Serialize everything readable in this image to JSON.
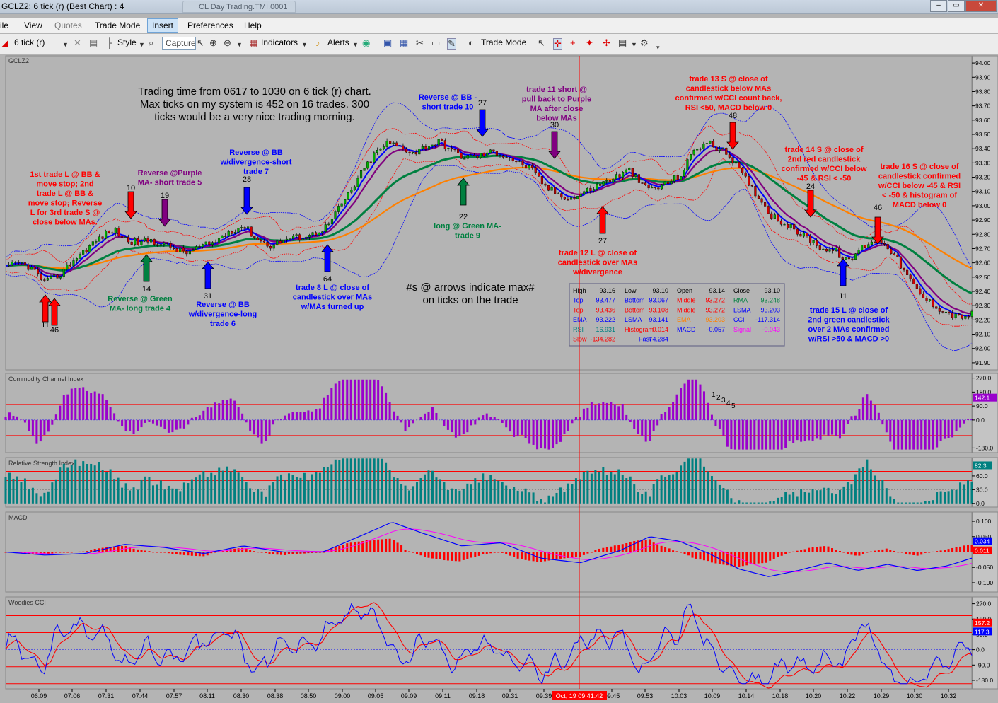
{
  "window": {
    "title": "GCLZ2: 6 tick (r) (Best Chart) : 4",
    "ghost_tab": "CL Day Trading.TMI.0001"
  },
  "menu": [
    "ile",
    "View",
    "Quotes",
    "Trade Mode",
    "Insert",
    "Preferences",
    "Help"
  ],
  "toolbar": {
    "interval": "6 tick (r)",
    "style": "Style",
    "capture_placeholder": "Capture",
    "indicators": "Indicators",
    "alerts": "Alerts",
    "trade_mode": "Trade Mode"
  },
  "symbol": "GCLZ2",
  "crosshair_label": "Oct, 19 09:41:42",
  "annotations": [
    {
      "text": [
        "Trading time from 0617 to 1030 on 6 tick (r) chart.",
        "Max ticks on my system is 452 on 16 trades. 300",
        "ticks would be a very nice trading morning."
      ],
      "color": "#000000"
    },
    {
      "text": [
        "1st trade L @ BB &",
        "move stop; 2nd",
        "trade L @ BB &",
        "move stop; Reverse",
        "L for 3rd trade S @",
        "close below MAs."
      ],
      "color": "#ff0000"
    },
    {
      "text": [
        "Reverse @Purple",
        "MA- short trade 5"
      ],
      "color": "#800080"
    },
    {
      "text": [
        "Reverse @ BB",
        "w/divergence-short",
        "trade 7"
      ],
      "color": "#0000ff"
    },
    {
      "text": [
        "Reverse @ BB -",
        "short trade 10"
      ],
      "color": "#0000ff"
    },
    {
      "text": [
        "trade 11 short @",
        "pull back to Purple",
        "MA after close",
        "below MAs"
      ],
      "color": "#800080"
    },
    {
      "text": [
        "trade 13 S @ close of",
        "candlestick below MAs",
        "confirmed w/CCI count back,",
        "RSI <50, MACD below 0"
      ],
      "color": "#ff0000"
    },
    {
      "text": [
        "trade 14 S @ close of",
        "2nd red candlestick",
        "confirmed w/CCI below",
        "-45 & RSI < -50"
      ],
      "color": "#ff0000"
    },
    {
      "text": [
        "trade 16 S @ close of",
        "candlestick confirmed",
        "w/CCI below -45 & RSI",
        "< -50 & histogram of",
        "MACD below 0"
      ],
      "color": "#ff0000"
    },
    {
      "text": [
        "Reverse @ Green",
        "MA- long trade 4"
      ],
      "color": "#008040"
    },
    {
      "text": [
        "Reverse @ BB",
        "w/divergence-long",
        "trade 6"
      ],
      "color": "#0000ff"
    },
    {
      "text": [
        "trade 8 L @ close of",
        "candlestick over MAs",
        "w/MAs turned up"
      ],
      "color": "#0000ff"
    },
    {
      "text": [
        "long @ Green MA-",
        "trade 9"
      ],
      "color": "#008040"
    },
    {
      "text": [
        "trade 12 L @ close of",
        "candlestick over MAs",
        "w/divergence"
      ],
      "color": "#ff0000"
    },
    {
      "text": [
        "#s @ arrows indicate max#",
        "on ticks on the trade"
      ],
      "color": "#000000"
    },
    {
      "text": [
        "trade 15 L @ close of",
        "2nd green candlestick",
        "over 2 MAs confirmed",
        "w/RSI >50 & MACD >0"
      ],
      "color": "#0000ff"
    }
  ],
  "arrow_numbers": [
    "10",
    "19",
    "28",
    "27",
    "30",
    "48",
    "24",
    "46",
    "11",
    "46",
    "14",
    "31",
    "64",
    "22",
    "27",
    "11"
  ],
  "cci_count_labels": [
    "1",
    "2",
    "3",
    "4",
    "5"
  ],
  "info_box": [
    [
      {
        "k": "High",
        "v": "93.16",
        "c": "#000000"
      },
      {
        "k": "Low",
        "v": "93.10",
        "c": "#000000"
      },
      {
        "k": "Open",
        "v": "93.14",
        "c": "#000000"
      },
      {
        "k": "Close",
        "v": "93.10",
        "c": "#000000"
      }
    ],
    [
      {
        "k": "Top",
        "v": "93.477",
        "c": "#0000ff"
      },
      {
        "k": "Bottom",
        "v": "93.067",
        "c": "#0000ff"
      },
      {
        "k": "Middle",
        "v": "93.272",
        "c": "#ff0000"
      },
      {
        "k": "RMA",
        "v": "93.248",
        "c": "#008040"
      }
    ],
    [
      {
        "k": "Top",
        "v": "93.436",
        "c": "#ff0000"
      },
      {
        "k": "Bottom",
        "v": "93.108",
        "c": "#ff0000"
      },
      {
        "k": "Middle",
        "v": "93.272",
        "c": "#ff0000"
      },
      {
        "k": "LSMA",
        "v": "93.203",
        "c": "#0000ff"
      }
    ],
    [
      {
        "k": "EMA",
        "v": "93.222",
        "c": "#0000ff"
      },
      {
        "k": "LSMA",
        "v": "93.141",
        "c": "#0000ff"
      },
      {
        "k": "EMA",
        "v": "93.203",
        "c": "#ff8000"
      },
      {
        "k": "CCI",
        "v": "-117.314",
        "c": "#0000ff"
      }
    ],
    [
      {
        "k": "RSI",
        "v": "16.931",
        "c": "#008080"
      },
      {
        "k": "Histogram",
        "v": "-0.014",
        "c": "#ff0000"
      },
      {
        "k": "MACD",
        "v": "-0.057",
        "c": "#0000ff"
      },
      {
        "k": "Signal",
        "v": "-0.043",
        "c": "#ff00ff"
      }
    ],
    [
      {
        "k": "Slow",
        "v": "-134.282",
        "c": "#ff0000"
      },
      {
        "k": "Fast",
        "v": "-74.284",
        "c": "#0000ff"
      }
    ]
  ],
  "time_labels": [
    "06:09",
    "07:06",
    "07:31",
    "07:44",
    "07:57",
    "08:11",
    "08:30",
    "08:38",
    "08:50",
    "09:00",
    "09:05",
    "09:09",
    "09:11",
    "09:18",
    "09:31",
    "09:39",
    "09:45",
    "09:53",
    "10:03",
    "10:09",
    "10:14",
    "10:18",
    "10:20",
    "10:22",
    "10:29",
    "10:30",
    "10:32"
  ],
  "colors": {
    "ma_purple": "#800080",
    "ma_blue": "#0000ff",
    "ma_green": "#008040",
    "ema_orange": "#ff8000",
    "bb_blue": "#0000ff",
    "bb_red": "#ff0000",
    "cci": "#9900cc",
    "rsi": "#008080",
    "macd_line": "#0000ff",
    "macd_signal": "#ff00ff"
  },
  "chart_data": [
    {
      "type": "candlestick",
      "title": "GCLZ2",
      "ylim": [
        91.85,
        94.05
      ],
      "yticks": [
        "94.00",
        "93.90",
        "93.80",
        "93.70",
        "93.60",
        "93.50",
        "93.40",
        "93.30",
        "93.20",
        "93.10",
        "93.00",
        "92.90",
        "92.80",
        "92.70",
        "92.60",
        "92.50",
        "92.40",
        "92.30",
        "92.20",
        "92.10",
        "92.00",
        "91.90"
      ],
      "close_path": [
        [
          0,
          92.56
        ],
        [
          12,
          92.6
        ],
        [
          25,
          92.57
        ],
        [
          40,
          92.46
        ],
        [
          55,
          92.52
        ],
        [
          70,
          92.63
        ],
        [
          85,
          92.72
        ],
        [
          100,
          92.8
        ],
        [
          110,
          92.83
        ],
        [
          122,
          92.76
        ],
        [
          135,
          92.74
        ],
        [
          146,
          92.76
        ],
        [
          158,
          92.73
        ],
        [
          170,
          92.7
        ],
        [
          182,
          92.67
        ],
        [
          196,
          92.71
        ],
        [
          210,
          92.74
        ],
        [
          225,
          92.82
        ],
        [
          240,
          92.86
        ],
        [
          255,
          92.76
        ],
        [
          268,
          92.72
        ],
        [
          280,
          92.76
        ],
        [
          295,
          92.78
        ],
        [
          310,
          92.8
        ],
        [
          325,
          92.86
        ],
        [
          338,
          93.0
        ],
        [
          350,
          93.12
        ],
        [
          360,
          93.24
        ],
        [
          372,
          93.36
        ],
        [
          385,
          93.44
        ],
        [
          400,
          93.41
        ],
        [
          412,
          93.37
        ],
        [
          425,
          93.42
        ],
        [
          438,
          93.45
        ],
        [
          450,
          93.39
        ],
        [
          462,
          93.34
        ],
        [
          478,
          93.35
        ],
        [
          492,
          93.38
        ],
        [
          505,
          93.35
        ],
        [
          518,
          93.3
        ],
        [
          530,
          93.26
        ],
        [
          545,
          93.13
        ],
        [
          558,
          93.08
        ],
        [
          572,
          93.05
        ],
        [
          585,
          93.1
        ],
        [
          600,
          93.15
        ],
        [
          615,
          93.2
        ],
        [
          630,
          93.25
        ],
        [
          642,
          93.14
        ],
        [
          655,
          93.12
        ],
        [
          668,
          93.16
        ],
        [
          682,
          93.22
        ],
        [
          695,
          93.4
        ],
        [
          708,
          93.44
        ],
        [
          720,
          93.4
        ],
        [
          732,
          93.34
        ],
        [
          745,
          93.2
        ],
        [
          760,
          93.06
        ],
        [
          772,
          92.94
        ],
        [
          785,
          92.88
        ],
        [
          798,
          92.82
        ],
        [
          812,
          92.76
        ],
        [
          825,
          92.7
        ],
        [
          838,
          92.68
        ],
        [
          850,
          92.6
        ],
        [
          862,
          92.7
        ],
        [
          875,
          92.76
        ],
        [
          888,
          92.74
        ],
        [
          900,
          92.62
        ],
        [
          912,
          92.48
        ],
        [
          925,
          92.36
        ],
        [
          938,
          92.3
        ],
        [
          950,
          92.25
        ],
        [
          962,
          92.22
        ],
        [
          975,
          92.24
        ]
      ]
    },
    {
      "type": "bar",
      "title": "Commodity Channel Index",
      "ylim": [
        -210,
        300
      ],
      "yticks": [
        "270.0",
        "180.0",
        "90.0",
        "0.0",
        "-180.0"
      ],
      "last_value": "142.1"
    },
    {
      "type": "bar",
      "title": "Relative Strength Index",
      "ylim": [
        -8,
        100
      ],
      "yticks": [
        "60.0",
        "30.0",
        "0.0"
      ],
      "last_value": "82.3"
    },
    {
      "type": "line",
      "title": "MACD",
      "ylim": [
        -0.13,
        0.13
      ],
      "yticks": [
        "0.100",
        "0.050",
        "-0.050",
        "-0.100"
      ],
      "last_values": [
        "0.034",
        "0.011"
      ],
      "macd": [
        [
          0,
          0.0
        ],
        [
          40,
          -0.01
        ],
        [
          80,
          -0.005
        ],
        [
          120,
          0.025
        ],
        [
          160,
          0.015
        ],
        [
          200,
          -0.005
        ],
        [
          240,
          0.02
        ],
        [
          280,
          0.0
        ],
        [
          320,
          0.0
        ],
        [
          360,
          0.055
        ],
        [
          390,
          0.097
        ],
        [
          420,
          0.062
        ],
        [
          460,
          0.02
        ],
        [
          500,
          0.03
        ],
        [
          540,
          -0.02
        ],
        [
          580,
          -0.035
        ],
        [
          620,
          0.005
        ],
        [
          650,
          0.05
        ],
        [
          680,
          0.035
        ],
        [
          710,
          -0.005
        ],
        [
          740,
          -0.055
        ],
        [
          770,
          -0.08
        ],
        [
          800,
          -0.06
        ],
        [
          830,
          -0.035
        ],
        [
          860,
          -0.06
        ],
        [
          890,
          -0.04
        ],
        [
          920,
          -0.06
        ],
        [
          950,
          -0.045
        ],
        [
          975,
          -0.02
        ]
      ]
    },
    {
      "type": "line",
      "title": "Woodies CCI",
      "ylim": [
        -230,
        310
      ],
      "yticks": [
        "270.0",
        "180.0",
        "90.0",
        "0.0",
        "-90.0",
        "-180.0"
      ],
      "last_values": [
        "157.2",
        "117.3"
      ]
    }
  ]
}
